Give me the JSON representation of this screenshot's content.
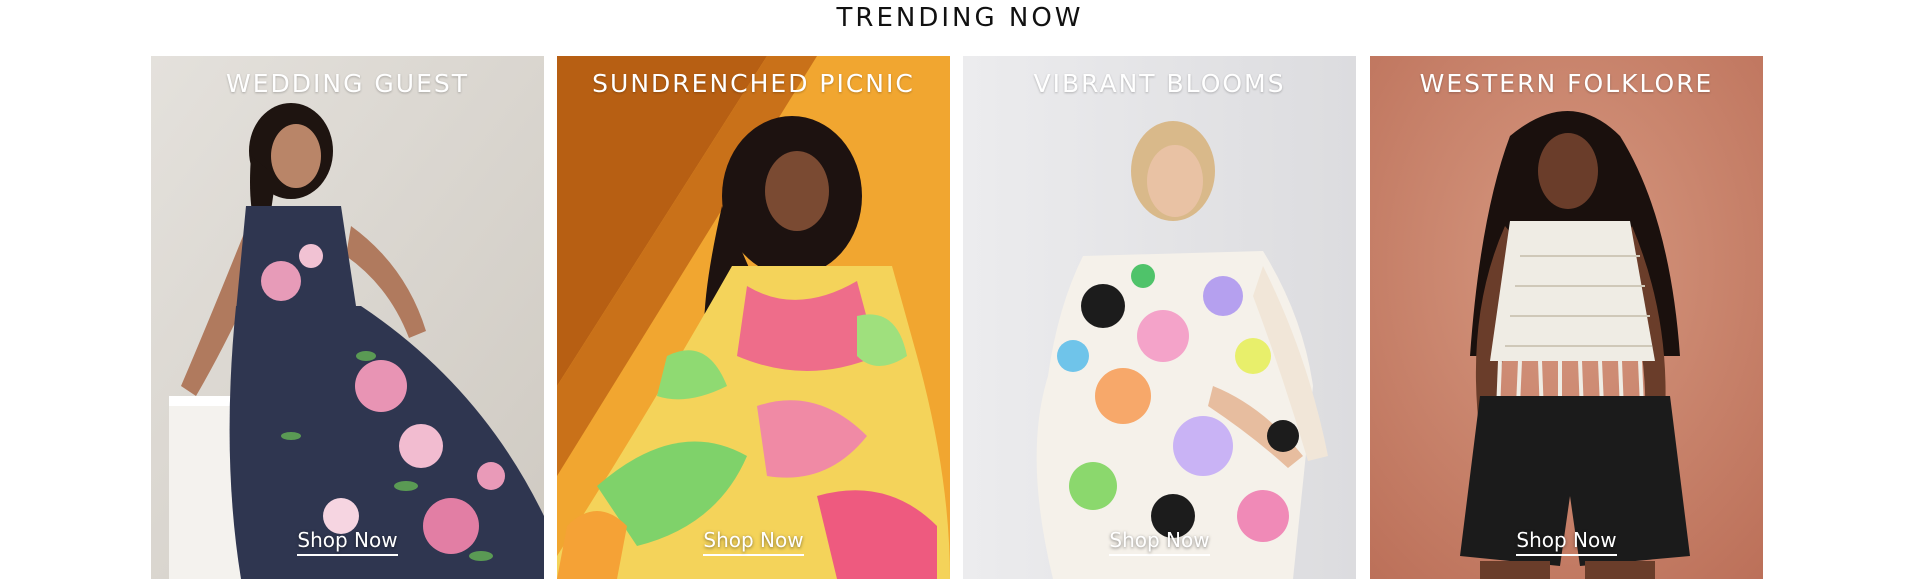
{
  "section": {
    "title": "TRENDING NOW"
  },
  "tiles": [
    {
      "heading": "WEDDING GUEST",
      "cta": "Shop Now",
      "image": "model-in-navy-floral-maxi-dress"
    },
    {
      "heading": "SUNDRENCHED PICNIC",
      "cta": "Shop Now",
      "image": "model-in-bright-abstract-print-dress"
    },
    {
      "heading": "VIBRANT BLOOMS",
      "cta": "Shop Now",
      "image": "model-in-bold-floral-print-dress"
    },
    {
      "heading": "WESTERN FOLKLORE",
      "cta": "Shop Now",
      "image": "model-in-crochet-fringe-top-and-shorts"
    }
  ],
  "colors": {
    "title_text": "#111111",
    "overlay_text": "#ffffff",
    "tile1_backdrop": "#dcd8d2",
    "tile2_backdrop": "#f0a12c",
    "tile3_backdrop": "#e4e4e6",
    "tile4_backdrop": "#c98068"
  }
}
